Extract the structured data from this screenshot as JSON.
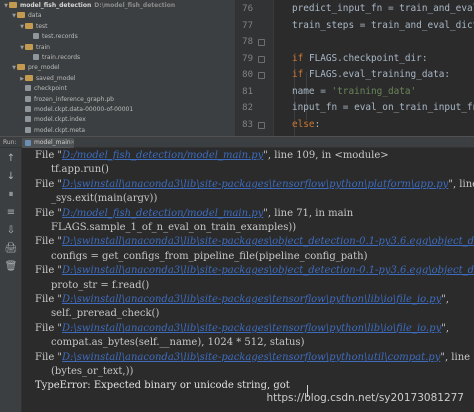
{
  "project_tree": {
    "items": [
      {
        "label": "model_fish_detection",
        "path": "D:\\model_fish_detection",
        "kind": "folder",
        "indent": 0,
        "arrow": "▼"
      },
      {
        "label": "data",
        "kind": "folder",
        "indent": 1,
        "arrow": "▼"
      },
      {
        "label": "test",
        "kind": "folder",
        "indent": 2,
        "arrow": "▼"
      },
      {
        "label": "test.records",
        "kind": "file",
        "indent": 3,
        "arrow": ""
      },
      {
        "label": "train",
        "kind": "folder",
        "indent": 2,
        "arrow": "▼"
      },
      {
        "label": "train.records",
        "kind": "file",
        "indent": 3,
        "arrow": ""
      },
      {
        "label": "pre_model",
        "kind": "folder",
        "indent": 1,
        "arrow": "▼"
      },
      {
        "label": "saved_model",
        "kind": "folder",
        "indent": 2,
        "arrow": "▶"
      },
      {
        "label": "checkpoint",
        "kind": "file",
        "indent": 2,
        "arrow": ""
      },
      {
        "label": "frozen_inference_graph.pb",
        "kind": "file",
        "indent": 2,
        "arrow": ""
      },
      {
        "label": "model.ckpt.data-00000-of-00001",
        "kind": "file",
        "indent": 2,
        "arrow": ""
      },
      {
        "label": "model.ckpt.index",
        "kind": "file",
        "indent": 2,
        "arrow": ""
      },
      {
        "label": "model.ckpt.meta",
        "kind": "file",
        "indent": 2,
        "arrow": ""
      }
    ]
  },
  "editor": {
    "lines": [
      {
        "num": "76",
        "html": "predict_input_fn = train_and_eval_d"
      },
      {
        "num": "77",
        "html": "train_steps = train_and_eval_dict['tr"
      },
      {
        "num": "78",
        "html": ""
      },
      {
        "num": "79",
        "html": "<span class=\"kw\">if</span> FLAGS.checkpoint_dir:"
      },
      {
        "num": "80",
        "html": "  <span class=\"kw\">if</span> FLAGS.eval_training_data:"
      },
      {
        "num": "81",
        "html": "    name = <span class=\"str\">'training_data'</span>"
      },
      {
        "num": "82",
        "html": "    input_fn = eval_on_train_input_fn"
      },
      {
        "num": "83",
        "html": "  <span class=\"kw\">else</span>:"
      }
    ]
  },
  "run_panel": {
    "label": "Run:",
    "tab_label": "model_main",
    "close_glyph": "×"
  },
  "side_tools": [
    "↑",
    "↓",
    "⏸",
    "≡",
    "⇩",
    "🖨",
    "🗑"
  ],
  "console": {
    "lines": [
      {
        "indent": false,
        "prefix": "File \"",
        "link": "D:/model_fish_detection/model_main.py",
        "suffix": "\", line 109, in <module>"
      },
      {
        "indent": true,
        "text": "tf.app.run()"
      },
      {
        "indent": false,
        "prefix": "File \"",
        "link": "D:\\swinstall\\anaconda3\\lib\\site-packages\\tensorflow\\python\\platform\\app.py",
        "suffix": "\", line"
      },
      {
        "indent": true,
        "text": "_sys.exit(main(argv))"
      },
      {
        "indent": false,
        "prefix": "File \"",
        "link": "D:/model_fish_detection/model_main.py",
        "suffix": "\", line 71, in main"
      },
      {
        "indent": true,
        "text": "FLAGS.sample_1_of_n_eval_on_train_examples))"
      },
      {
        "indent": false,
        "prefix": "File \"",
        "link": "D:\\swinstall\\anaconda3\\lib\\site-packages\\object_detection-0.1-py3.6.egg\\object_d",
        "suffix": ""
      },
      {
        "indent": true,
        "text": "configs = get_configs_from_pipeline_file(pipeline_config_path)"
      },
      {
        "indent": false,
        "prefix": "File \"",
        "link": "D:\\swinstall\\anaconda3\\lib\\site-packages\\object_detection-0.1-py3.6.egg\\object_d",
        "suffix": ""
      },
      {
        "indent": true,
        "text": "proto_str = f.read()"
      },
      {
        "indent": false,
        "prefix": "File \"",
        "link": "D:\\swinstall\\anaconda3\\lib\\site-packages\\tensorflow\\python\\lib\\io\\file_io.py",
        "suffix": "\","
      },
      {
        "indent": true,
        "text": "self._preread_check()"
      },
      {
        "indent": false,
        "prefix": "File \"",
        "link": "D:\\swinstall\\anaconda3\\lib\\site-packages\\tensorflow\\python\\lib\\io\\file_io.py",
        "suffix": "\","
      },
      {
        "indent": true,
        "text": "compat.as_bytes(self.__name), 1024 * 512, status)"
      },
      {
        "indent": false,
        "prefix": "File \"",
        "link": "D:\\swinstall\\anaconda3\\lib\\site-packages\\tensorflow\\python\\util\\compat.py",
        "suffix": "\", line"
      },
      {
        "indent": true,
        "text": "(bytes_or_text,))"
      },
      {
        "indent": false,
        "error": true,
        "text": "TypeError: Expected binary or unicode string, got"
      }
    ]
  },
  "watermark": "https://blog.csdn.net/sy20173081277"
}
